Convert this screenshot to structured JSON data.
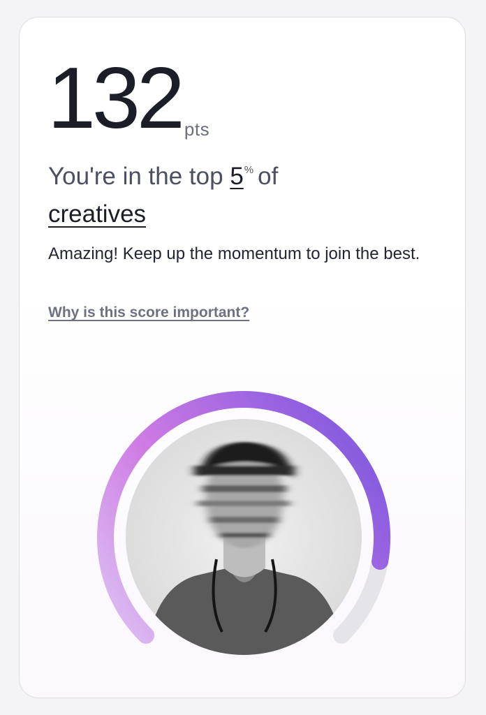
{
  "score": {
    "value": "132",
    "unit": "pts"
  },
  "ranking": {
    "prefix": "You're in the top",
    "percent": "5",
    "percent_sign": "%",
    "of": "of",
    "category": "creatives"
  },
  "message": "Amazing! Keep up the momentum to join the best.",
  "help_link": "Why is this score important?",
  "gauge": {
    "progress": 0.87,
    "gradient_start": "#dcc3f3",
    "gradient_mid": "#cf7be4",
    "gradient_end": "#8a5de0",
    "track_color": "#e4e4ea"
  }
}
